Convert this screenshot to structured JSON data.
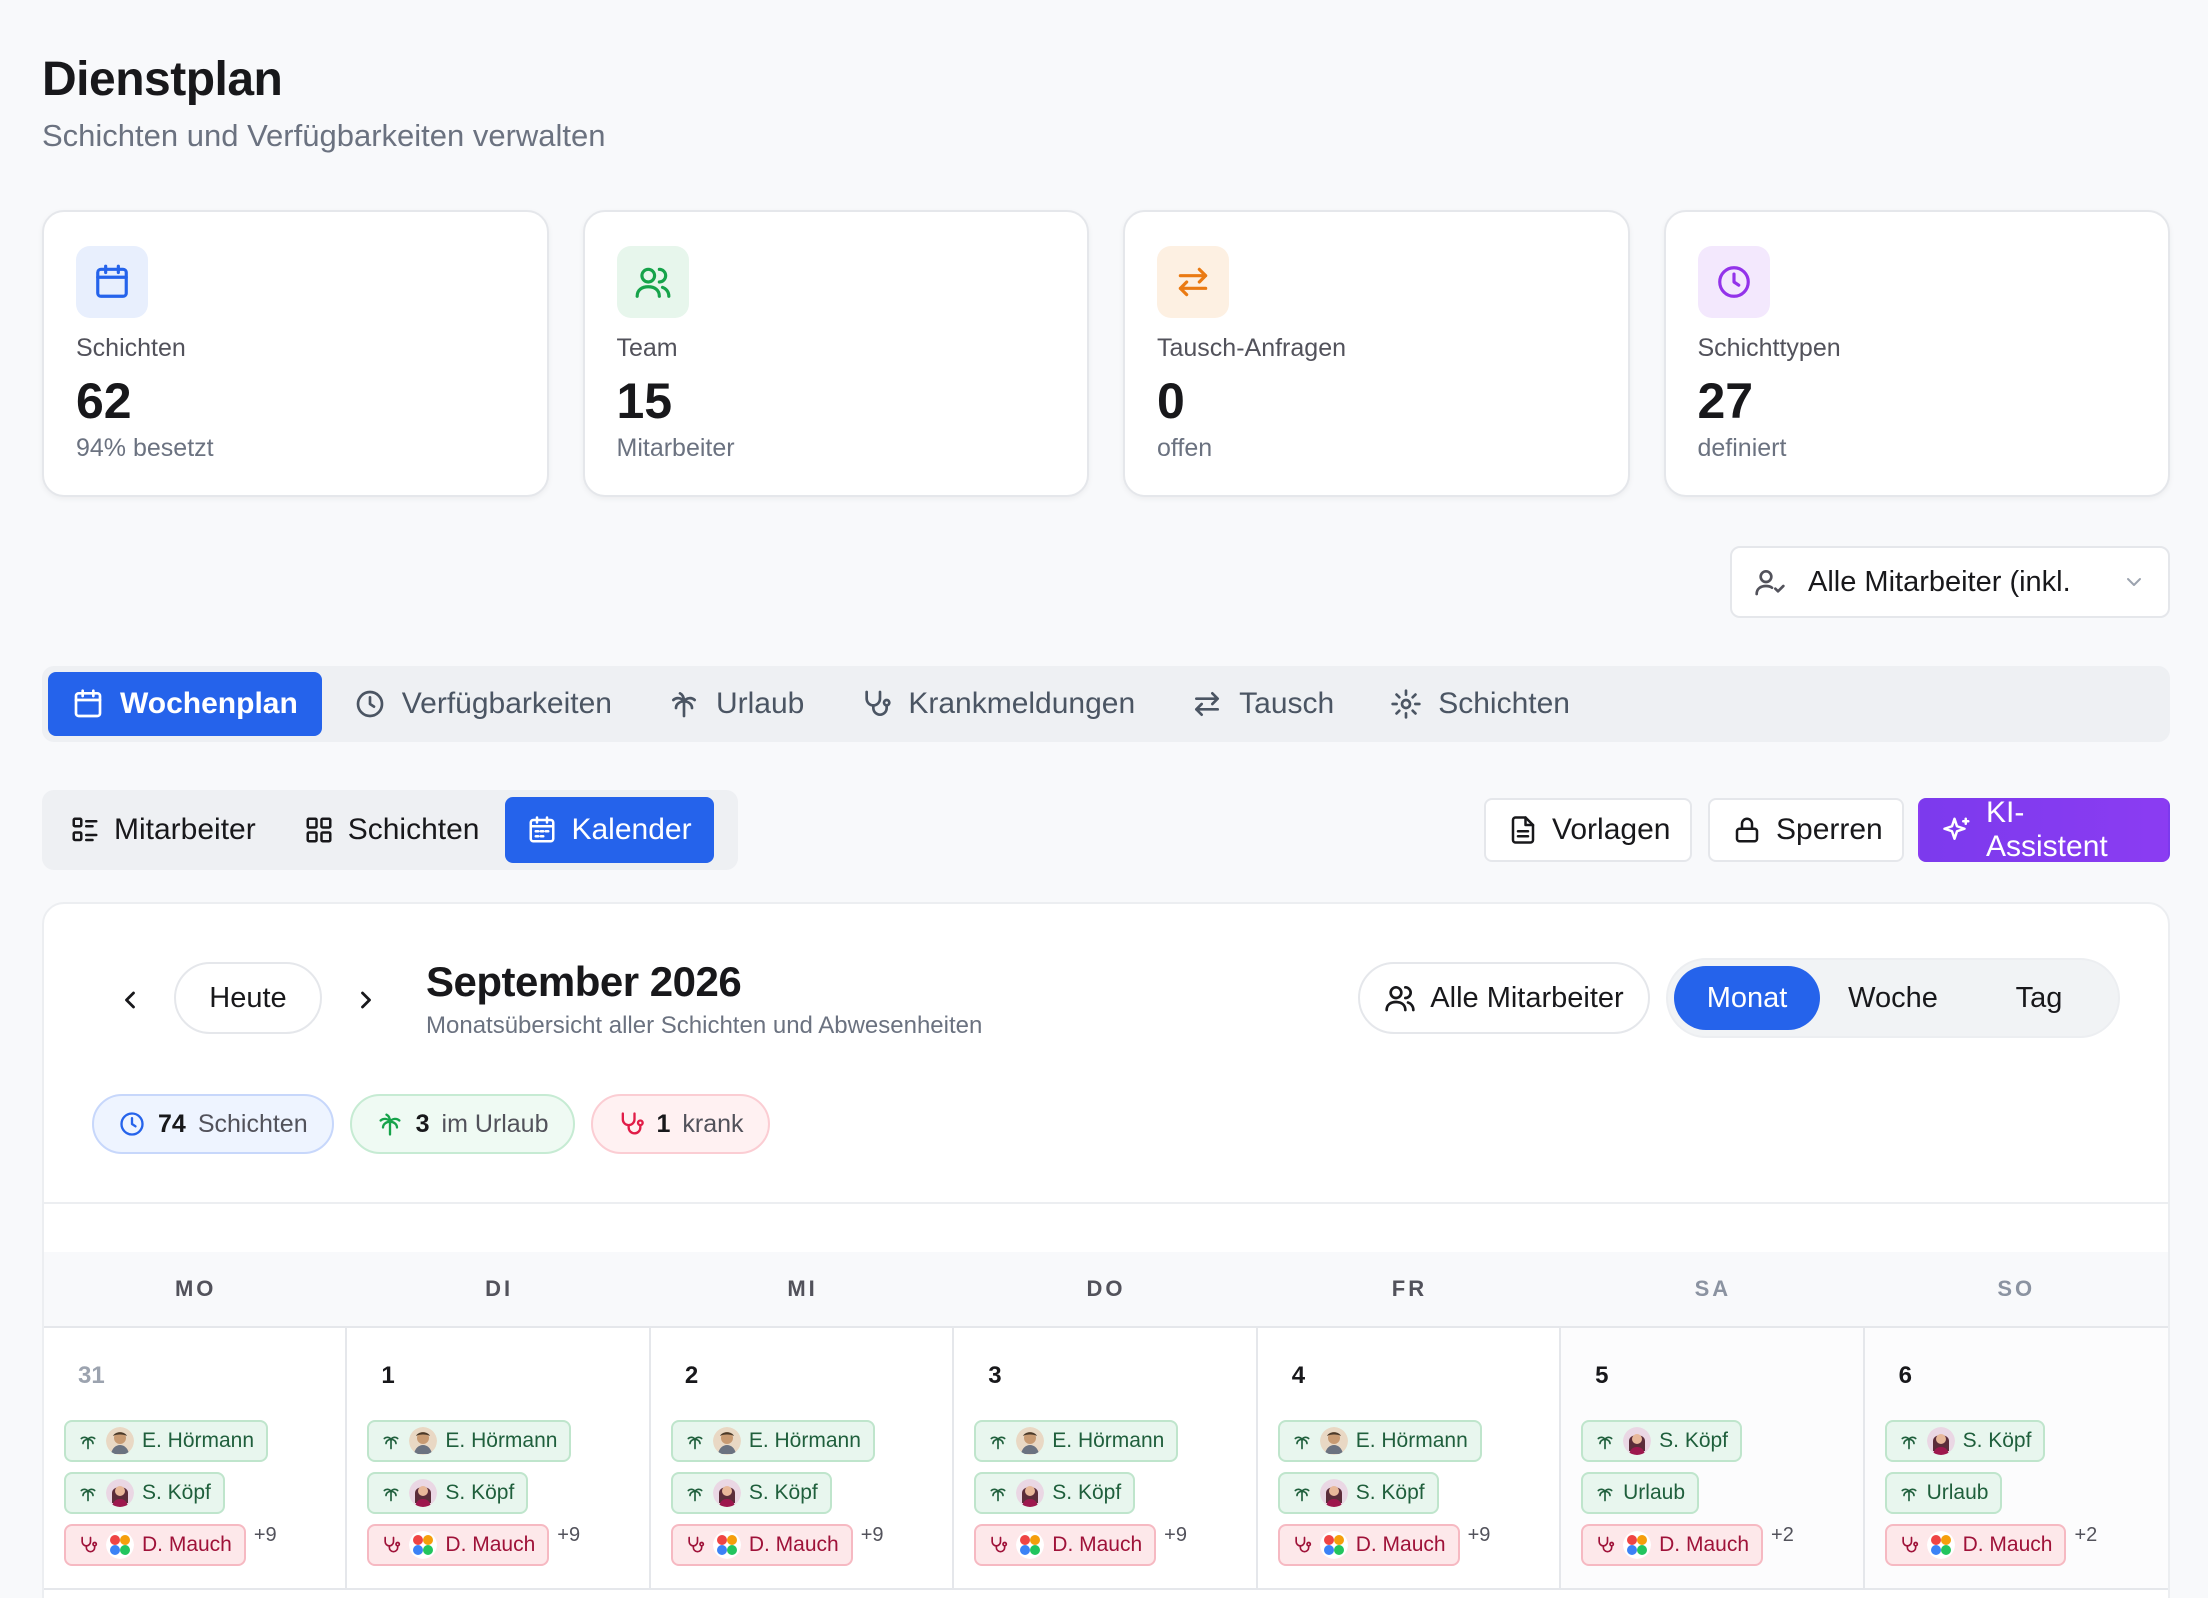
{
  "header": {
    "title": "Dienstplan",
    "subtitle": "Schichten und Verfügbarkeiten verwalten"
  },
  "stats": [
    {
      "label": "Schichten",
      "value": "62",
      "sub": "94% besetzt",
      "icon": "calendar-icon",
      "color": "#2563eb",
      "bg": "#e8effd"
    },
    {
      "label": "Team",
      "value": "15",
      "sub": "Mitarbeiter",
      "icon": "users-icon",
      "color": "#16a34a",
      "bg": "#e7f6ec"
    },
    {
      "label": "Tausch-Anfragen",
      "value": "0",
      "sub": "offen",
      "icon": "swap-icon",
      "color": "#ea7a12",
      "bg": "#fdf0e2"
    },
    {
      "label": "Schichttypen",
      "value": "27",
      "sub": "definiert",
      "icon": "clock-icon",
      "color": "#9333ea",
      "bg": "#f3e8fd"
    }
  ],
  "employee_filter": {
    "value": "Alle Mitarbeiter (inkl."
  },
  "main_tabs": [
    {
      "label": "Wochenplan",
      "icon": "calendar-icon",
      "active": true
    },
    {
      "label": "Verfügbarkeiten",
      "icon": "clock-icon"
    },
    {
      "label": "Urlaub",
      "icon": "palm-tree-icon"
    },
    {
      "label": "Krankmeldungen",
      "icon": "stethoscope-icon"
    },
    {
      "label": "Tausch",
      "icon": "swap-icon"
    },
    {
      "label": "Schichten",
      "icon": "gear-icon"
    }
  ],
  "view_tabs": [
    {
      "label": "Mitarbeiter",
      "icon": "list-icon"
    },
    {
      "label": "Schichten",
      "icon": "grid-icon"
    },
    {
      "label": "Kalender",
      "icon": "calendar-icon",
      "active": true
    }
  ],
  "toolbar": {
    "templates": "Vorlagen",
    "lock": "Sperren",
    "ai": "KI-Assistent"
  },
  "calendar": {
    "today": "Heute",
    "title": "September 2026",
    "subtitle": "Monatsübersicht aller Schichten und Abwesenheiten",
    "all_employees": "Alle Mitarbeiter",
    "ranges": [
      "Monat",
      "Woche",
      "Tag"
    ],
    "active_range": "Monat",
    "summary": {
      "shifts_count": "74",
      "shifts_label": "Schichten",
      "vacation_count": "3",
      "vacation_label": "im Urlaub",
      "sick_count": "1",
      "sick_label": "krank"
    },
    "weekdays": [
      "MO",
      "DI",
      "MI",
      "DO",
      "FR",
      "SA",
      "SO"
    ],
    "days": [
      {
        "num": "31",
        "muted": true,
        "entries": [
          {
            "type": "vacation",
            "name": "E. Hörmann",
            "avatar": "hoermann"
          },
          {
            "type": "vacation",
            "name": "S. Köpf",
            "avatar": "koepf"
          },
          {
            "type": "sick",
            "name": "D. Mauch",
            "avatar": "mauch"
          }
        ],
        "more": "+9"
      },
      {
        "num": "1",
        "entries": [
          {
            "type": "vacation",
            "name": "E. Hörmann",
            "avatar": "hoermann"
          },
          {
            "type": "vacation",
            "name": "S. Köpf",
            "avatar": "koepf"
          },
          {
            "type": "sick",
            "name": "D. Mauch",
            "avatar": "mauch"
          }
        ],
        "more": "+9"
      },
      {
        "num": "2",
        "entries": [
          {
            "type": "vacation",
            "name": "E. Hörmann",
            "avatar": "hoermann"
          },
          {
            "type": "vacation",
            "name": "S. Köpf",
            "avatar": "koepf"
          },
          {
            "type": "sick",
            "name": "D. Mauch",
            "avatar": "mauch"
          }
        ],
        "more": "+9"
      },
      {
        "num": "3",
        "entries": [
          {
            "type": "vacation",
            "name": "E. Hörmann",
            "avatar": "hoermann"
          },
          {
            "type": "vacation",
            "name": "S. Köpf",
            "avatar": "koepf"
          },
          {
            "type": "sick",
            "name": "D. Mauch",
            "avatar": "mauch"
          }
        ],
        "more": "+9"
      },
      {
        "num": "4",
        "entries": [
          {
            "type": "vacation",
            "name": "E. Hörmann",
            "avatar": "hoermann"
          },
          {
            "type": "vacation",
            "name": "S. Köpf",
            "avatar": "koepf"
          },
          {
            "type": "sick",
            "name": "D. Mauch",
            "avatar": "mauch"
          }
        ],
        "more": "+9"
      },
      {
        "num": "5",
        "weekend": true,
        "entries": [
          {
            "type": "vacation",
            "name": "S. Köpf",
            "avatar": "koepf"
          },
          {
            "type": "vacation",
            "name": "Urlaub"
          },
          {
            "type": "sick",
            "name": "D. Mauch",
            "avatar": "mauch"
          }
        ],
        "more": "+2"
      },
      {
        "num": "6",
        "weekend": true,
        "entries": [
          {
            "type": "vacation",
            "name": "S. Köpf",
            "avatar": "koepf"
          },
          {
            "type": "vacation",
            "name": "Urlaub"
          },
          {
            "type": "sick",
            "name": "D. Mauch",
            "avatar": "mauch"
          }
        ],
        "more": "+2"
      }
    ]
  }
}
